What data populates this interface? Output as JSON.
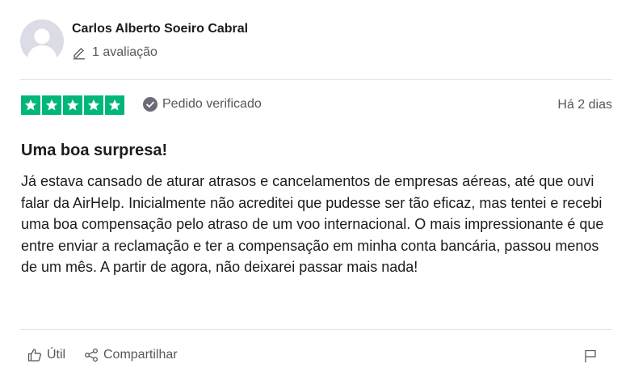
{
  "reviewer": {
    "name": "Carlos Alberto Soeiro Cabral",
    "review_count": "1 avaliação",
    "avatar_icon": "user-silhouette-icon"
  },
  "rating": {
    "stars": 5,
    "max_stars": 5,
    "star_color": "#00b67a",
    "verified_label": "Pedido verificado",
    "verified_icon": "check-circle-icon",
    "date": "Há 2 dias"
  },
  "review": {
    "title": "Uma boa surpresa!",
    "body": "Já estava cansado de aturar atrasos e cancelamentos de empresas aéreas, até que ouvi falar da AirHelp. Inicialmente não acreditei que pudesse ser tão eficaz, mas tentei e recebi uma boa compensação pelo atraso de um voo internacional. O mais impressionante é que entre enviar a reclamação e ter a compensação em minha conta bancária, passou menos de um mês. A partir de agora, não deixarei passar mais nada!"
  },
  "actions": {
    "useful_label": "Útil",
    "useful_icon": "thumbs-up-icon",
    "share_label": "Compartilhar",
    "share_icon": "share-icon",
    "flag_icon": "flag-icon"
  }
}
